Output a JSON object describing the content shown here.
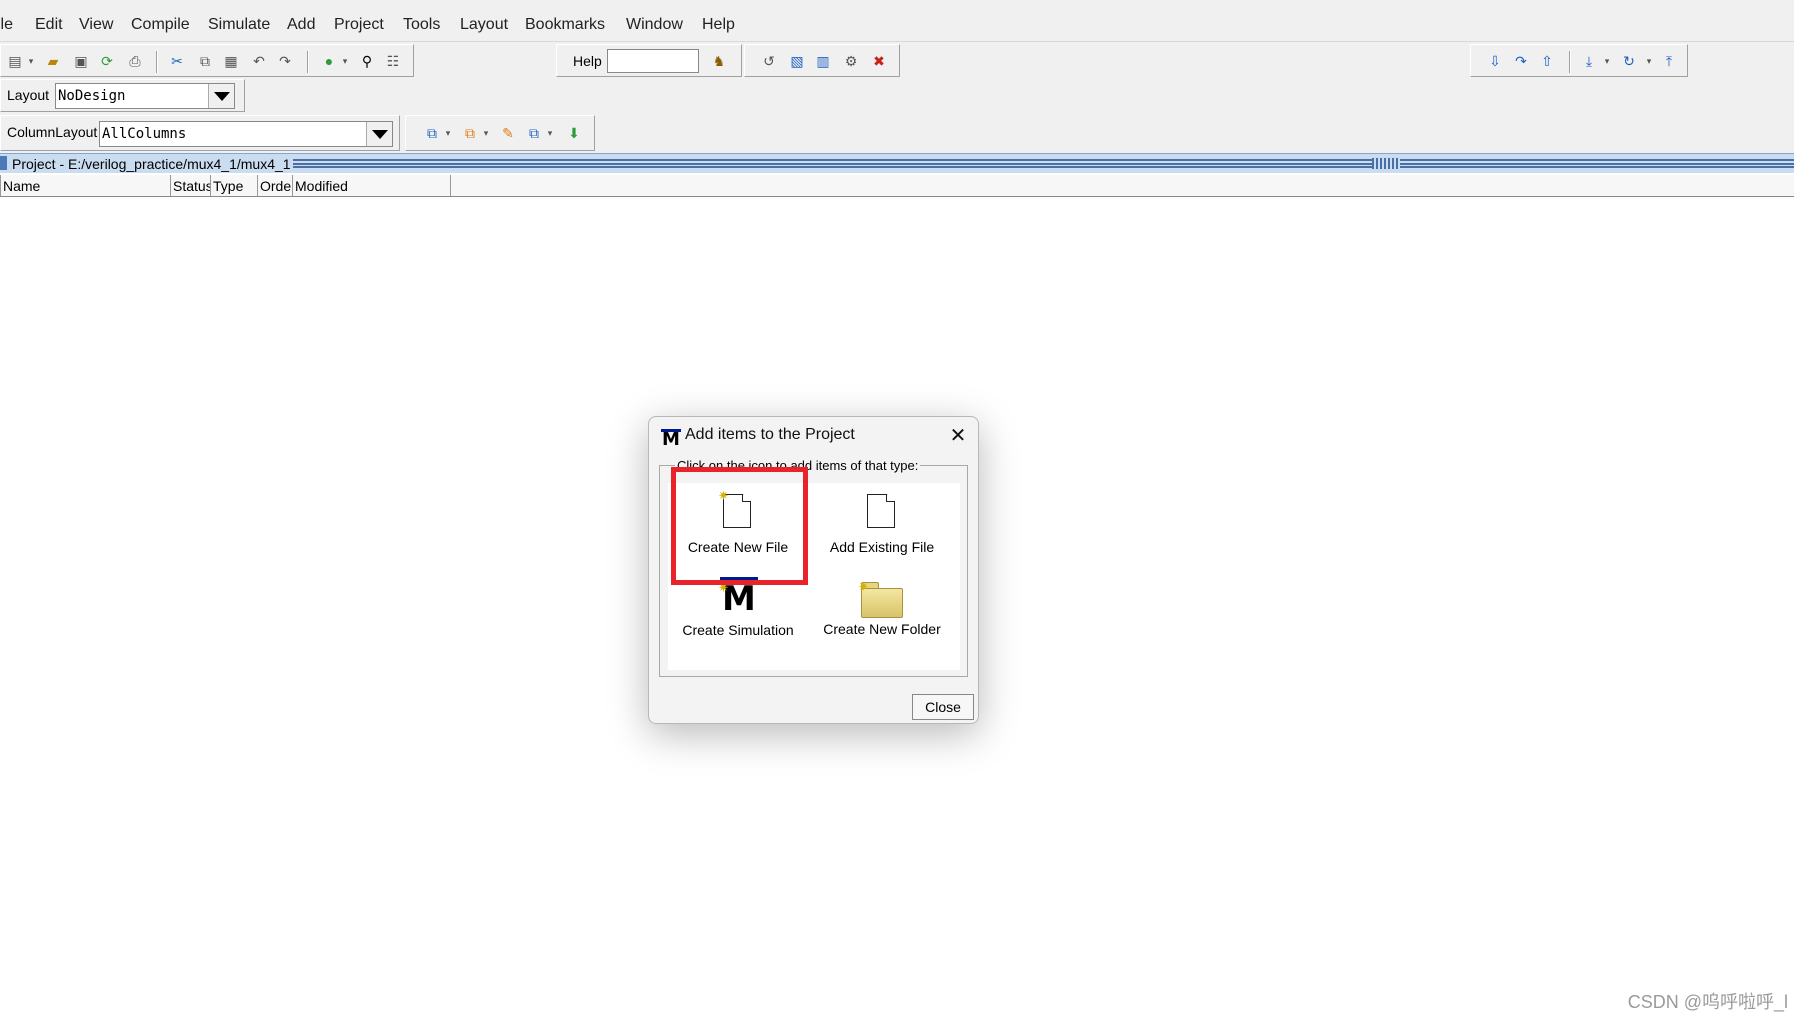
{
  "menu": {
    "items": [
      "ile",
      "Edit",
      "View",
      "Compile",
      "Simulate",
      "Add",
      "Project",
      "Tools",
      "Layout",
      "Bookmarks",
      "Window",
      "Help"
    ]
  },
  "toolbar": {
    "help_label": "Help",
    "help_value": "",
    "icons_left": [
      "new-file-icon",
      "open-folder-icon",
      "save-icon",
      "refresh-icon",
      "print-icon",
      "cut-icon",
      "copy-icon",
      "paste-icon",
      "undo-icon",
      "redo-icon",
      "compile-icon",
      "find-icon",
      "hierarchy-icon"
    ],
    "icons_mid": [
      "help-search-icon",
      "sim-back-icon",
      "sim-doc-icon",
      "sim-grid-icon",
      "sim-break-icon",
      "sim-stop-icon"
    ],
    "icons_right": [
      "step-into-icon",
      "step-over-icon",
      "step-out-icon",
      "step-down-icon",
      "continue-icon",
      "restart-icon"
    ]
  },
  "layout_bar": {
    "label": "Layout",
    "value": "NoDesign"
  },
  "column_layout_bar": {
    "label": "ColumnLayout",
    "value": "AllColumns"
  },
  "project_pane": {
    "title": "Project - E:/verilog_practice/mux4_1/mux4_1",
    "columns": [
      "Name",
      "Status",
      "Type",
      "Order",
      "Modified"
    ]
  },
  "dialog": {
    "title": "Add items to the Project",
    "group_label": "Click on the icon to add items of that type:",
    "tiles": [
      {
        "label": "Create New File",
        "icon": "new-file-icon"
      },
      {
        "label": "Add Existing File",
        "icon": "existing-file-icon"
      },
      {
        "label": "Create Simulation",
        "icon": "modelsim-icon"
      },
      {
        "label": "Create New Folder",
        "icon": "folder-icon"
      }
    ],
    "close_label": "Close"
  },
  "colors": {
    "highlight": "#e8232a",
    "title_bar": "#c9dcf0",
    "accent_blue": "#001a8c"
  },
  "watermark": "CSDN @呜呼啦呼_l"
}
